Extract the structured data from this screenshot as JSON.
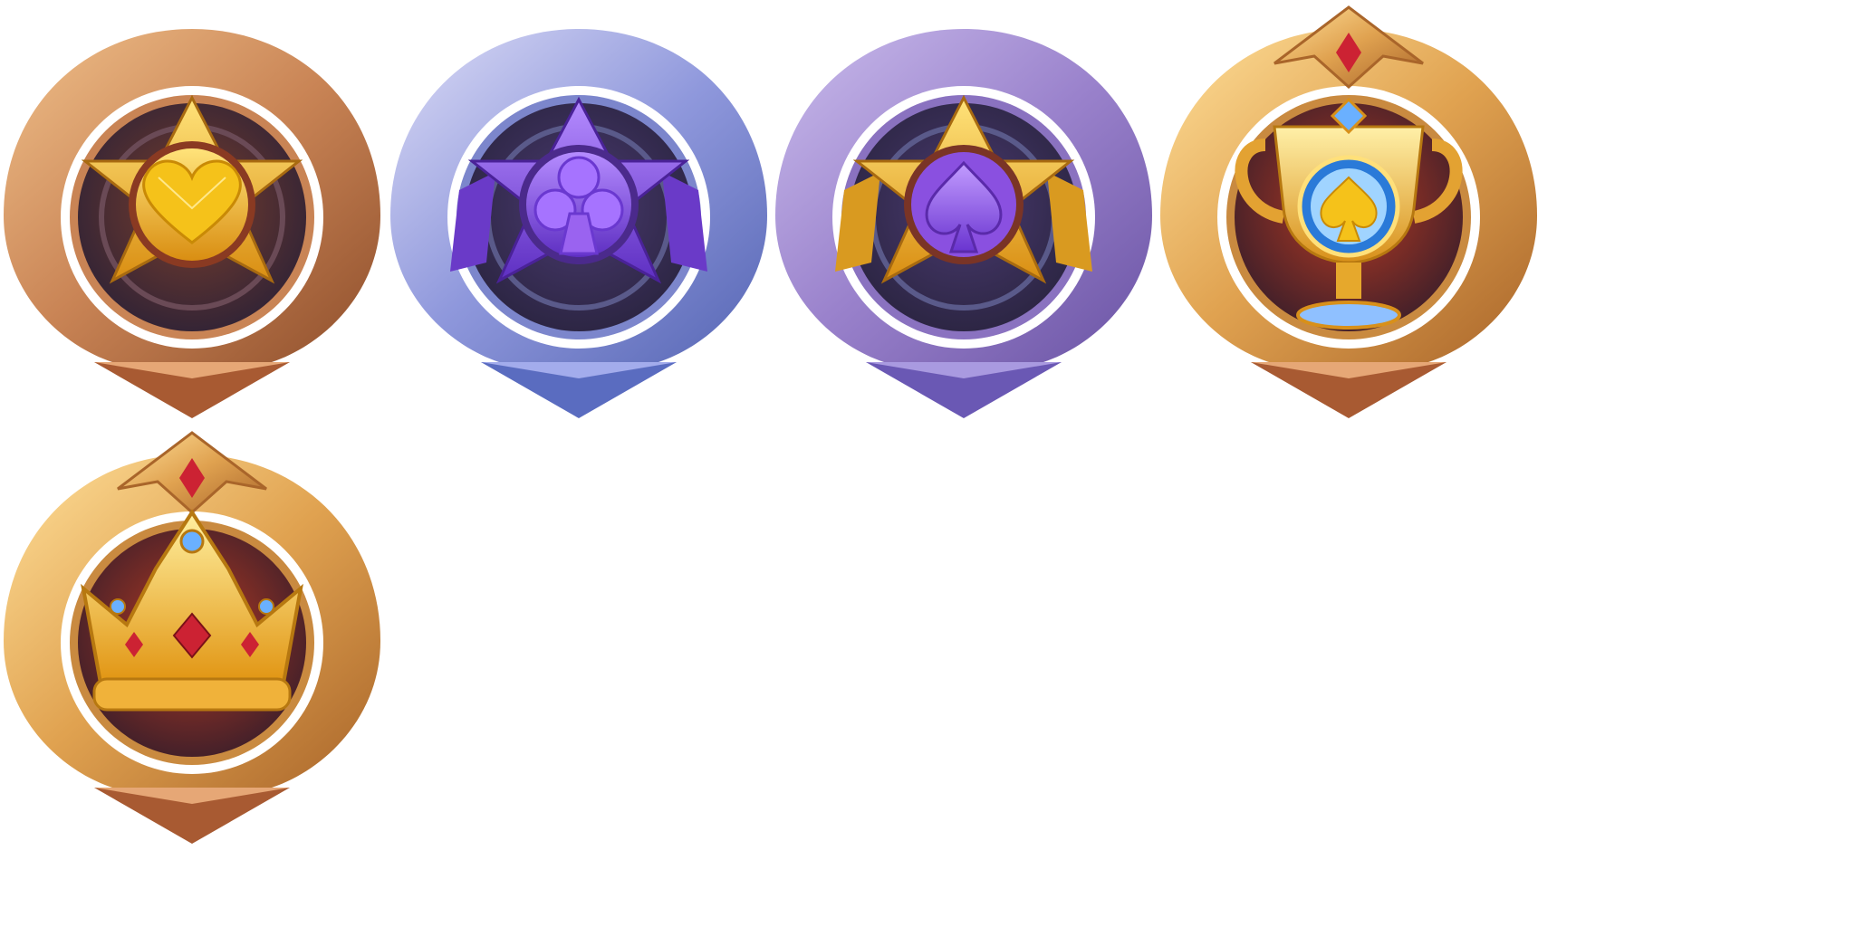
{
  "badges": [
    {
      "id": "rank-1",
      "frame": "bronze",
      "emblem": "heart",
      "star_color": "gold",
      "gem_color": "#f5c21a",
      "crest": false
    },
    {
      "id": "rank-2",
      "frame": "silver-blue",
      "emblem": "club",
      "star_color": "violet",
      "gem_color": "#9a63f0",
      "crest": false
    },
    {
      "id": "rank-3",
      "frame": "lavender",
      "emblem": "spade",
      "star_color": "gold",
      "gem_color": "#9a63f0",
      "crest": false
    },
    {
      "id": "rank-4",
      "frame": "gold",
      "emblem": "trophy-spade",
      "star_color": "none",
      "gem_color": "#f5c21a",
      "crest": true
    },
    {
      "id": "rank-5",
      "frame": "gold",
      "emblem": "crown",
      "star_color": "none",
      "gem_color": "#cc2233",
      "crest": true
    }
  ],
  "palette": {
    "bronze_light": "#e3a56a",
    "bronze_dark": "#a5603a",
    "blue_light": "#c9cbf0",
    "blue_dark": "#6a78c6",
    "lavender_light": "#b9a8e0",
    "lavender_dark": "#7a63b4",
    "gold_light": "#f8d27a",
    "gold_dark": "#c8842f",
    "inner_dark": "#3a2840",
    "inner_red": "#9e2a1e",
    "star_gold": "#f3b51c",
    "star_violet": "#8a56e8"
  }
}
